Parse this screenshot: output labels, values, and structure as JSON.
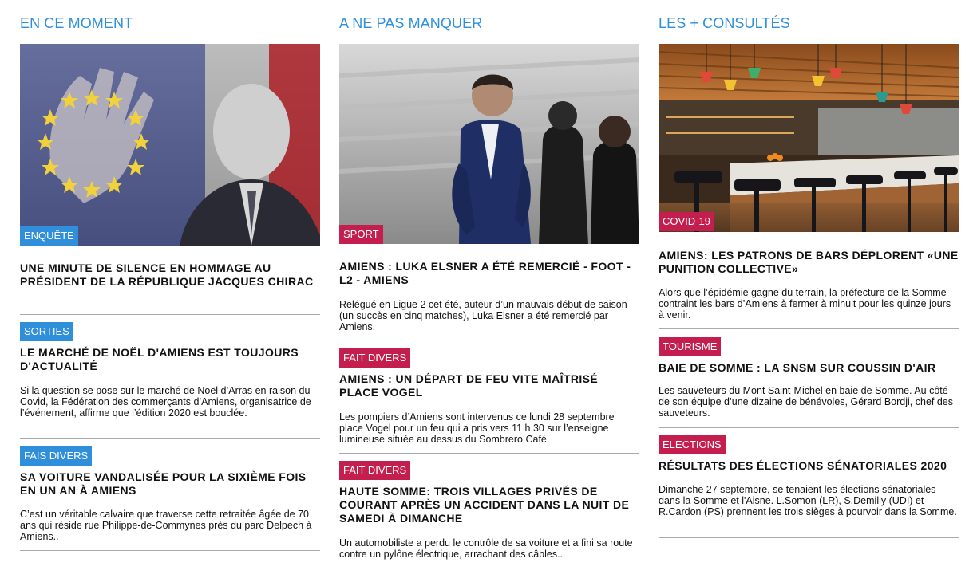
{
  "columns": [
    {
      "title": "EN CE MOMENT",
      "hero": {
        "category": "ENQUÊTE",
        "headline": "UNE MINUTE DE SILENCE EN HOMMAGE AU PRÉSIDENT DE LA RÉPUBLIQUE JACQUES CHIRAC",
        "image": "jacques-chirac-flag-photo"
      },
      "articles": [
        {
          "category": "SORTIES",
          "headline": "LE MARCHÉ DE NOËL D'AMIENS EST TOUJOURS D'ACTUALITÉ",
          "summary": "Si la question se pose sur le marché de Noël d’Arras en raison du Covid, la Fédération des commerçants d’Amiens, organisatrice de l’événement, affirme que l’édition 2020 est bouclée."
        },
        {
          "category": "FAIS DIVERS",
          "headline": "SA VOITURE VANDALISÉE POUR LA SIXIÈME FOIS EN UN AN À AMIENS",
          "summary": "C’est un véritable calvaire que traverse cette retraitée âgée de 70 ans qui réside rue Philippe-de-Commynes près du parc Delpech à Amiens.."
        }
      ]
    },
    {
      "title": "A NE PAS MANQUER",
      "hero": {
        "category": "SPORT",
        "headline": "AMIENS : LUKA ELSNER A ÉTÉ REMERCIÉ - FOOT - L2 - AMIENS",
        "summary": "Relégué en Ligue 2 cet été, auteur d’un mauvais début de saison (un succès en cinq matches), Luka Elsner a été remercié par Amiens.",
        "image": "luka-elsner-stadium-photo"
      },
      "articles": [
        {
          "category": "FAIT DIVERS",
          "headline": "AMIENS : UN DÉPART DE FEU VITE MAÎTRISÉ PLACE VOGEL",
          "summary": "Les pompiers d’Amiens sont intervenus ce lundi 28 septembre place Vogel pour un feu qui a pris vers 11 h 30 sur l’enseigne lumineuse située au dessus du Sombrero Café."
        },
        {
          "category": "FAIT DIVERS",
          "headline": "HAUTE SOMME: TROIS VILLAGES PRIVÉS DE COURANT APRÈS UN ACCIDENT DANS LA NUIT DE SAMEDI À DIMANCHE",
          "summary": "Un automobiliste a perdu le contrôle de sa voiture et a fini sa route contre un pylône électrique, arrachant des câbles.."
        }
      ]
    },
    {
      "title": "LES + CONSULTÉS",
      "hero": {
        "category": "COVID-19",
        "headline": "AMIENS: LES PATRONS DE BARS DÉPLORENT «UNE PUNITION COLLECTIVE»",
        "summary": "Alors que l’épidémie gagne du terrain, la préfecture de la Somme contraint les bars d’Amiens à fermer à minuit pour les quinze jours à venir.",
        "image": "bar-interior-photo"
      },
      "articles": [
        {
          "category": "TOURISME",
          "headline": "BAIE DE SOMME : LA SNSM SUR COUSSIN D'AIR",
          "summary": "Les sauveteurs du Mont Saint-Michel en baie de Somme. Au côté de son équipe d’une dizaine de bénévoles, Gérard Bordji, chef des sauveteurs."
        },
        {
          "category": "ELECTIONS",
          "headline": "RÉSULTATS DES ÉLECTIONS SÉNATORIALES 2020",
          "summary": "Dimanche 27 septembre, se tenaient les élections sénatoriales dans la Somme et l'Aisne. L.Somon (LR), S.Demilly (UDI) et R.Cardon (PS) prennent les trois sièges à pourvoir dans la Somme."
        }
      ]
    }
  ],
  "colors": {
    "accent_blue": "#2f8fdb",
    "accent_red": "#c41e4f",
    "separator": "#aaaaaa"
  }
}
